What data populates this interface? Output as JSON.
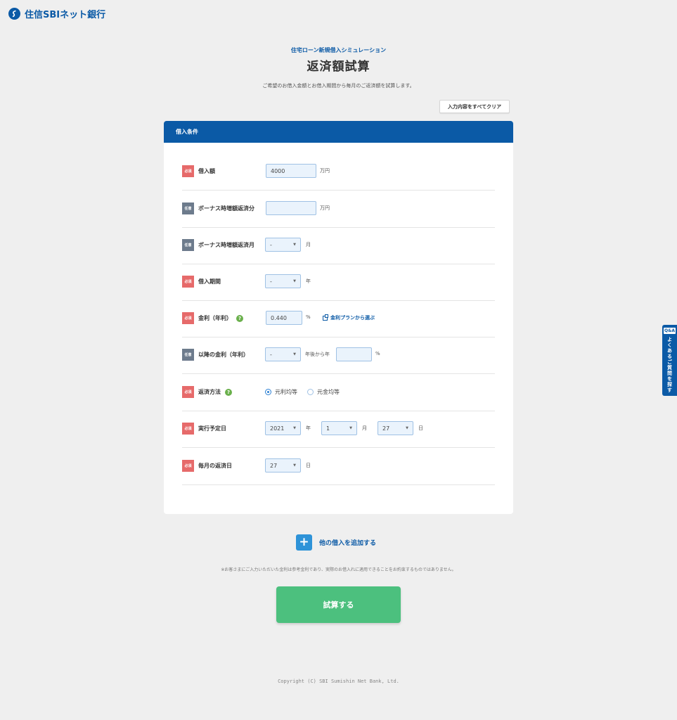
{
  "brand": {
    "name": "住信SBIネット銀行"
  },
  "hero": {
    "subtitle": "住宅ローン新規借入シミュレーション",
    "title": "返済額試算",
    "description": "ご希望のお借入金額とお借入期間から毎月のご返済額を試算します。"
  },
  "toolbar": {
    "clear_label": "入力内容をすべてクリア"
  },
  "card": {
    "title": "借入条件"
  },
  "badges": {
    "required": "必須",
    "optional": "任意"
  },
  "fields": {
    "loan_amount": {
      "label": "借入額",
      "value": "4000",
      "unit": "万円"
    },
    "bonus_amount": {
      "label": "ボーナス時増額返済分",
      "value": "",
      "unit": "万円"
    },
    "bonus_month": {
      "label": "ボーナス時増額返済月",
      "value": "-",
      "unit": "月"
    },
    "loan_period": {
      "label": "借入期間",
      "value": "-",
      "unit": "年"
    },
    "interest_rate": {
      "label": "金利（年利）",
      "value": "0.440",
      "unit": "%",
      "link": "金利プランから選ぶ"
    },
    "later_rate": {
      "label": "以降の金利（年利）",
      "year_value": "-",
      "year_unit": "年後から年",
      "rate_value": "",
      "rate_unit": "%"
    },
    "repayment_method": {
      "label": "返済方法",
      "options": [
        "元利均等",
        "元金均等"
      ],
      "selected": "元利均等"
    },
    "start_date": {
      "label": "実行予定日",
      "year": "2021",
      "year_unit": "年",
      "month": "1",
      "month_unit": "月",
      "day": "27",
      "day_unit": "日"
    },
    "monthly_day": {
      "label": "毎月の返済日",
      "value": "27",
      "unit": "日"
    }
  },
  "actions": {
    "add_loan_label": "他の借入を追加する",
    "submit_label": "試算する"
  },
  "note": "※お客さまにご入力いただいた金利は参考金利であり、実際のお借入れに適用できることをお約束するものではありません。",
  "footer": {
    "copyright": "Copyright (C) SBI Sumishin Net Bank, Ltd."
  },
  "qa_tab": {
    "badge": "Q&A",
    "label": "よくあるご質問を探す"
  },
  "colors": {
    "brand": "#0b5aa6",
    "required": "#e66a6a",
    "optional": "#6d7b8c",
    "submit": "#4cc07e"
  }
}
